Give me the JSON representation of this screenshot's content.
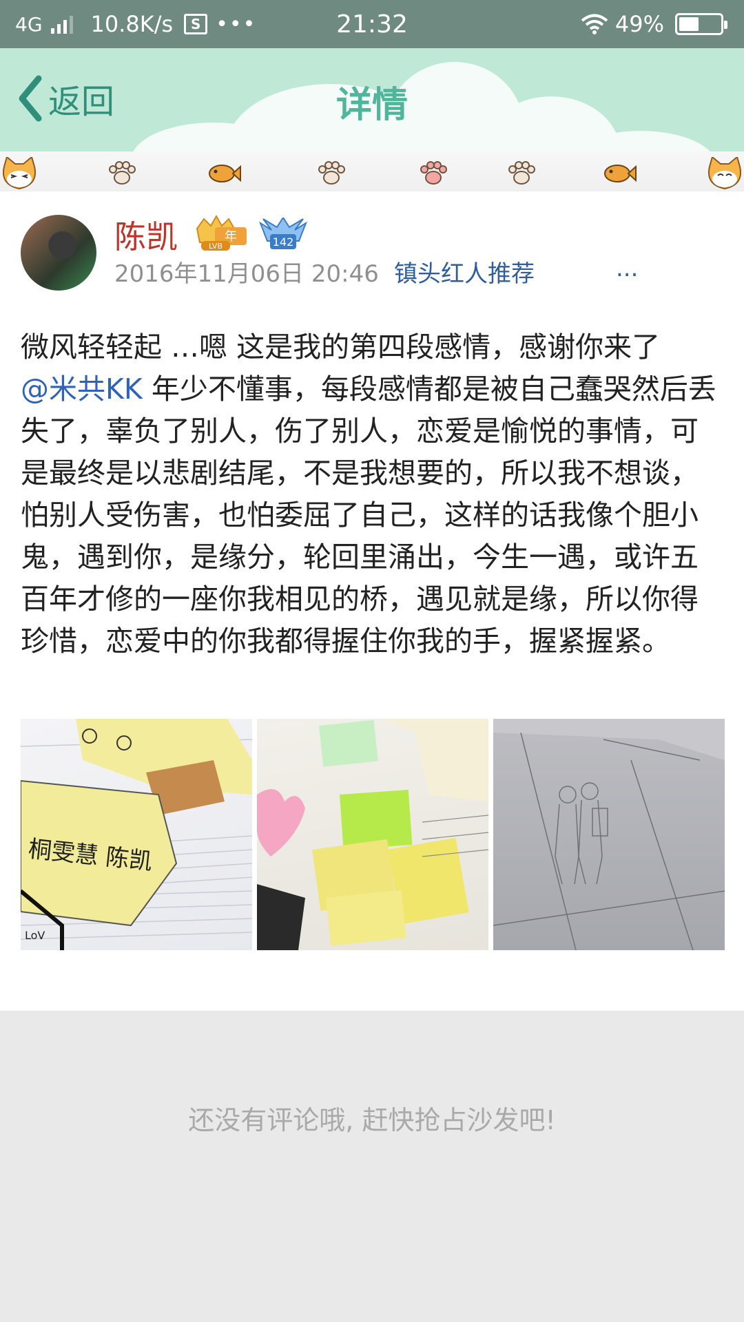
{
  "status_bar": {
    "network": "4G",
    "speed": "10.8K/s",
    "sim_icon_label": "S",
    "dots": "•••",
    "time": "21:32",
    "battery": "49%",
    "battery_level": 0.49
  },
  "header": {
    "back_label": "返回",
    "title": "详情"
  },
  "post": {
    "author": "陈凯",
    "vip_badge_text": "年",
    "vip_badge_sub": "LVB",
    "level_badge": "142",
    "timestamp": "2016年11月06日 20:46",
    "source": "镇头红人推荐",
    "more": "...",
    "text_before_mention": "微风轻轻起 …嗯 这是我的第四段感情，感谢你来了",
    "mention": "@米共KK",
    "text_after_mention": " 年少不懂事，每段感情都是被自己蠢哭然后丢失了，辜负了别人，伤了别人，恋爱是愉悦的事情，可是最终是以悲剧结尾，不是我想要的，所以我不想谈，怕别人受伤害，也怕委屈了自己，这样的话我像个胆小鬼，遇到你，是缘分，轮回里涌出，今生一遇，或许五百年才修的一座你我相见的桥，遇见就是缘，所以你得珍惜，恋爱中的你我都得握住你我的手，握紧握紧。",
    "photo_1_text": "桐雯慧   陈凯",
    "photo_1_corner": "LoV"
  },
  "comments": {
    "empty_text": "还没有评论哦, 赶快抢占沙发吧!"
  },
  "colors": {
    "status_bar": "#6f8a80",
    "header_bg": "#bfe9d6",
    "title": "#4fb59b",
    "author": "#c0332b",
    "link": "#2f5e9b"
  }
}
